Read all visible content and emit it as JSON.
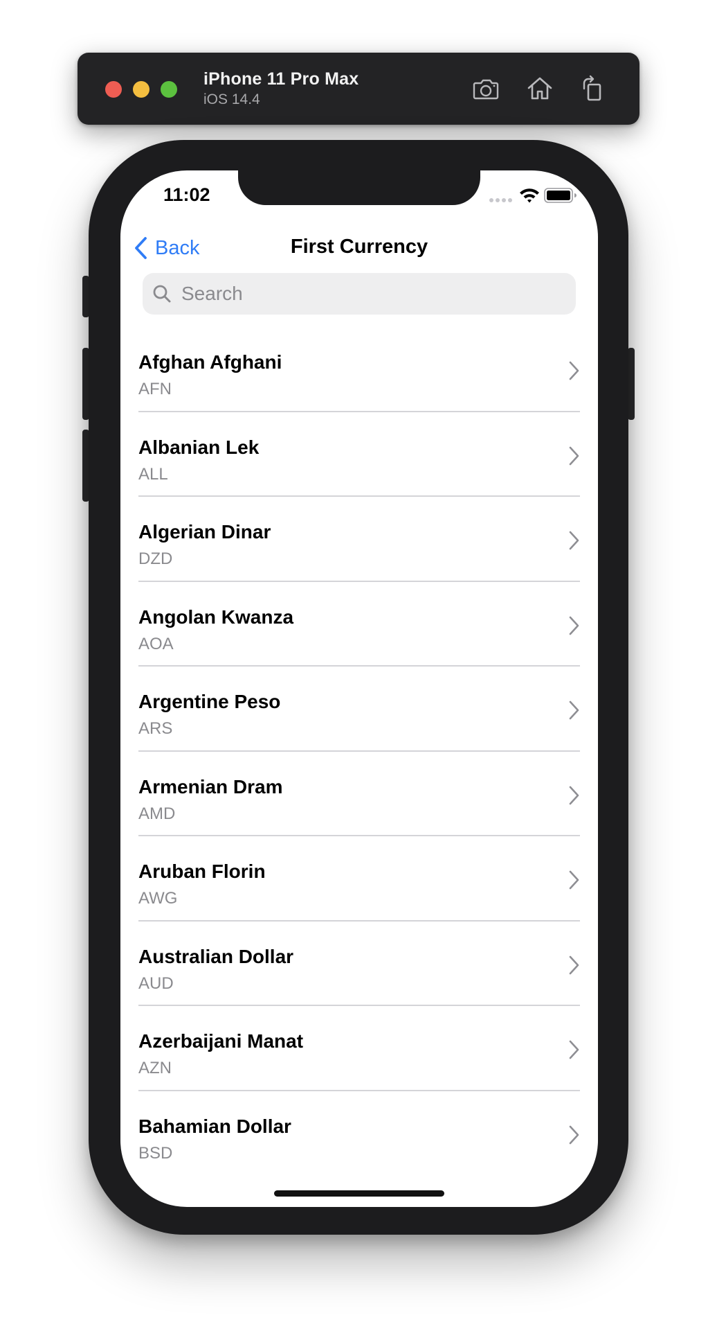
{
  "simulator": {
    "device_name": "iPhone 11 Pro Max",
    "os_version": "iOS 14.4",
    "icons": {
      "screenshot": "camera-icon",
      "home": "home-icon",
      "rotate": "rotate-icon"
    }
  },
  "status_bar": {
    "time": "11:02"
  },
  "nav": {
    "back_label": "Back",
    "title": "First Currency"
  },
  "search": {
    "placeholder": "Search",
    "value": ""
  },
  "colors": {
    "accent": "#2f7cf6",
    "secondary_text": "#8a8a8e"
  },
  "currencies": [
    {
      "name": "Afghan Afghani",
      "code": "AFN"
    },
    {
      "name": "Albanian Lek",
      "code": "ALL"
    },
    {
      "name": "Algerian Dinar",
      "code": "DZD"
    },
    {
      "name": "Angolan Kwanza",
      "code": "AOA"
    },
    {
      "name": "Argentine Peso",
      "code": "ARS"
    },
    {
      "name": "Armenian Dram",
      "code": "AMD"
    },
    {
      "name": "Aruban Florin",
      "code": "AWG"
    },
    {
      "name": "Australian Dollar",
      "code": "AUD"
    },
    {
      "name": "Azerbaijani Manat",
      "code": "AZN"
    },
    {
      "name": "Bahamian Dollar",
      "code": "BSD"
    }
  ]
}
